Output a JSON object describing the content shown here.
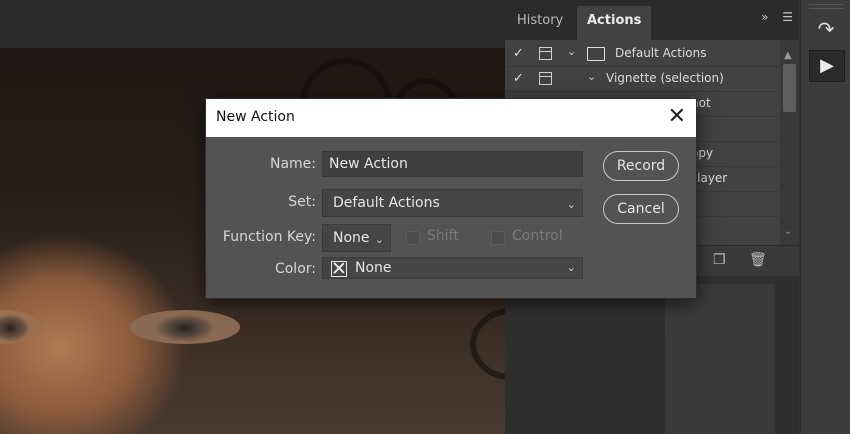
{
  "panel": {
    "tabs": [
      "History",
      "Actions"
    ],
    "collapse_icon": "double-chevron-right",
    "menu_icon": "hamburger",
    "actions": [
      {
        "label": "Default Actions",
        "checked": true,
        "type": "set"
      },
      {
        "label": "Vignette (selection)",
        "checked": true,
        "type": "action"
      },
      {
        "label": "hot",
        "checked": false,
        "type": "action"
      },
      {
        "label": "",
        "checked": false,
        "type": "action"
      },
      {
        "label": "opy",
        "checked": false,
        "type": "action"
      },
      {
        "label": "nt layer",
        "checked": false,
        "type": "action"
      },
      {
        "label": "",
        "checked": false,
        "type": "action"
      }
    ],
    "footer_icons": [
      "new-action-icon",
      "delete-icon"
    ]
  },
  "toolbar": {
    "icons": [
      "history-icon",
      "play-icon"
    ]
  },
  "dialog": {
    "title": "New Action",
    "name_label": "Name:",
    "name_value": "New Action",
    "set_label": "Set:",
    "set_value": "Default Actions",
    "function_key_label": "Function Key:",
    "function_key_value": "None",
    "shift_label": "Shift",
    "control_label": "Control",
    "color_label": "Color:",
    "color_value": "None",
    "record_button": "Record",
    "cancel_button": "Cancel"
  }
}
